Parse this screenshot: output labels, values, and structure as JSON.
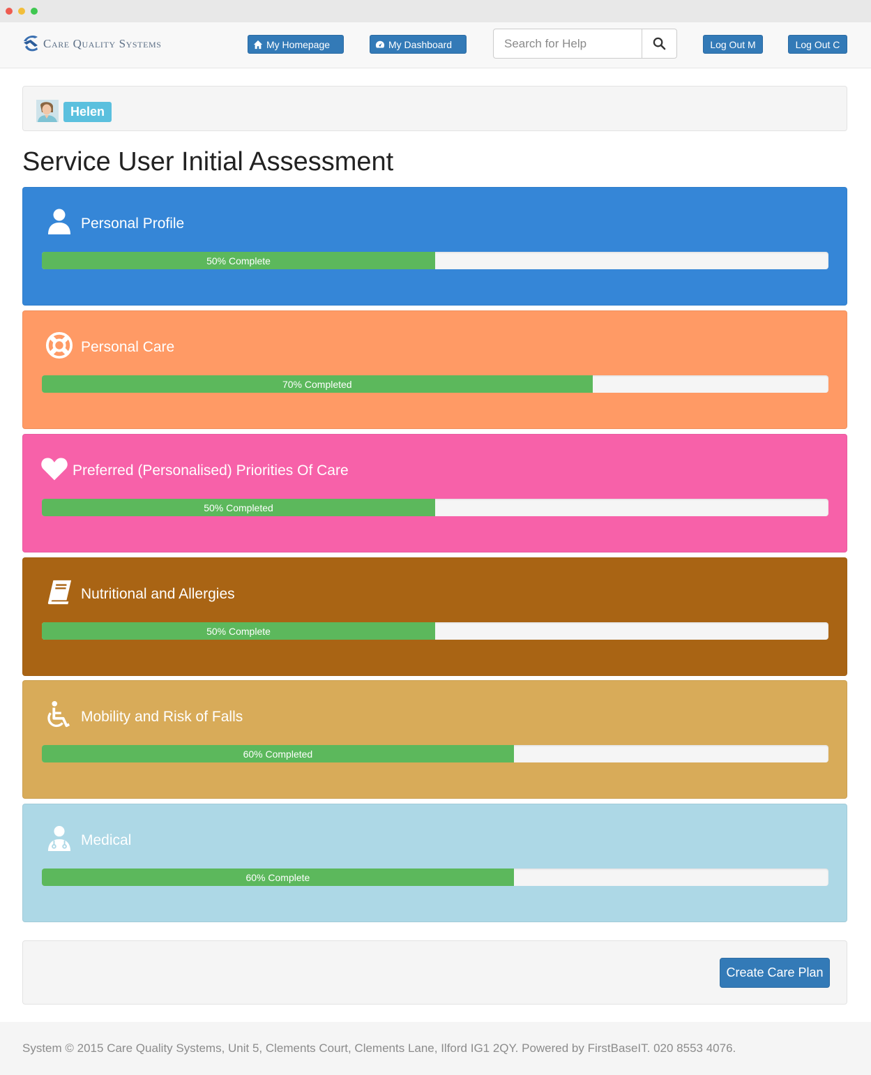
{
  "brand": {
    "name": "Care Quality Systems",
    "color": "#3a6fb0"
  },
  "nav": {
    "home_label": "My Homepage",
    "home_icon": "home-icon",
    "dashboard_label": "My Dashboard",
    "dashboard_icon": "dashboard-icon",
    "search_placeholder": "Search for Help",
    "search_value": "",
    "search_icon": "search-icon",
    "logout_m_label": "Log Out M",
    "logout_c_label": "Log Out C",
    "button_color": "#337ab7"
  },
  "user": {
    "name": "Helen",
    "badge_color": "#5bc0de"
  },
  "page": {
    "title": "Service User Initial Assessment"
  },
  "panels": [
    {
      "title": "Personal Profile",
      "icon": "user-icon",
      "color": "#3586d7",
      "progress": 50,
      "progress_label": "50% Complete"
    },
    {
      "title": "Personal Care",
      "icon": "life-ring-icon",
      "color": "#ff9a65",
      "progress": 70,
      "progress_label": "70% Completed"
    },
    {
      "title": "Preferred (Personalised) Priorities Of Care",
      "icon": "heart-icon",
      "color": "#f761a9",
      "progress": 50,
      "progress_label": "50% Completed"
    },
    {
      "title": "Nutritional and Allergies",
      "icon": "book-icon",
      "color": "#a96414",
      "progress": 50,
      "progress_label": "50% Complete"
    },
    {
      "title": "Mobility and Risk of Falls",
      "icon": "wheelchair-icon",
      "color": "#d8ab59",
      "progress": 60,
      "progress_label": "60% Completed"
    },
    {
      "title": "Medical",
      "icon": "doctor-icon",
      "color": "#add8e6",
      "progress": 60,
      "progress_label": "60% Complete"
    }
  ],
  "progress_color": "#5cb85c",
  "actions": {
    "create_label": "Create Care Plan"
  },
  "footer": {
    "text": "System © 2015 Care Quality Systems, Unit 5, Clements Court, Clements Lane, Ilford IG1 2QY. Powered by FirstBaseIT. 020 8553 4076."
  }
}
